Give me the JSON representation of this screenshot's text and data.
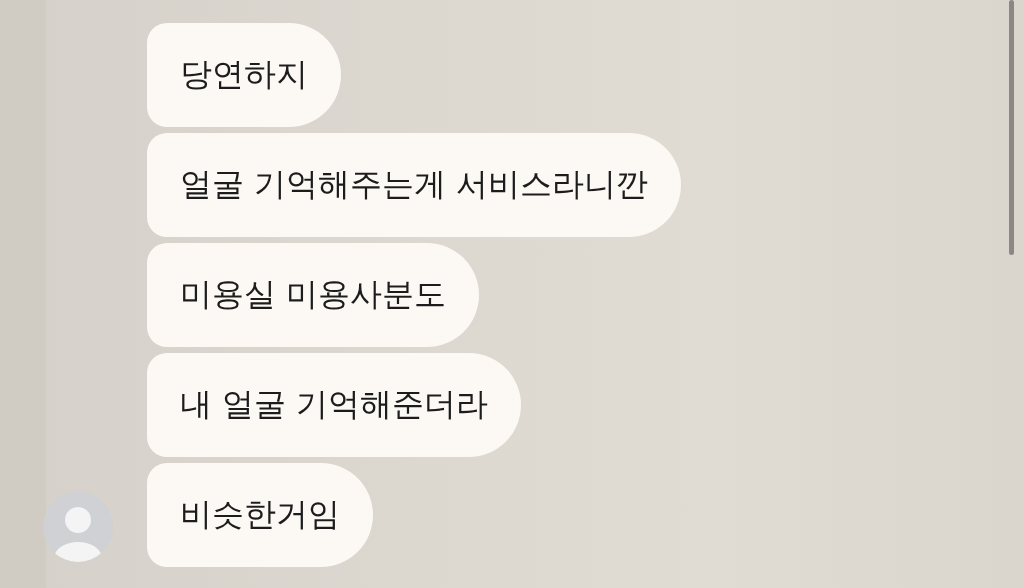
{
  "messages": [
    {
      "text": "당연하지"
    },
    {
      "text": "얼굴 기억해주는게 서비스라니깐"
    },
    {
      "text": "미용실 미용사분도"
    },
    {
      "text": "내 얼굴 기억해준더라"
    },
    {
      "text": "비슷한거임"
    }
  ]
}
